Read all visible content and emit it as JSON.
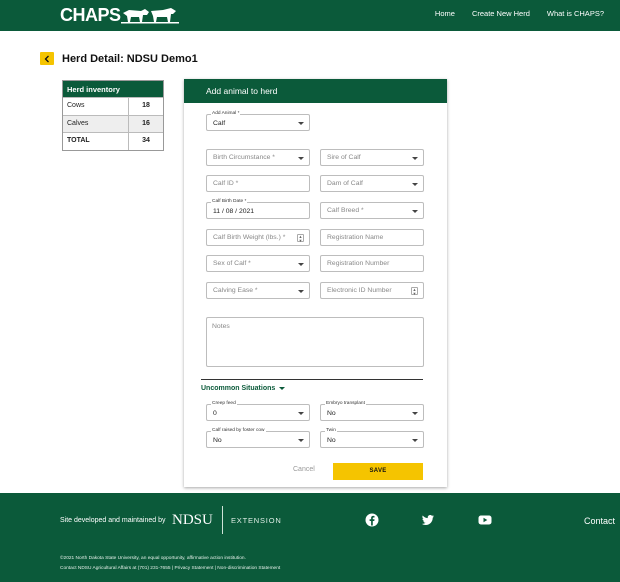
{
  "brand": {
    "logo_text": "CHAPS"
  },
  "nav": {
    "home": "Home",
    "create": "Create New Herd",
    "what": "What is CHAPS?"
  },
  "page": {
    "title": "Herd Detail: NDSU Demo1"
  },
  "inventory": {
    "heading": "Herd inventory",
    "rows": [
      {
        "label": "Cows",
        "value": "18"
      },
      {
        "label": "Calves",
        "value": "16"
      },
      {
        "label": "TOTAL",
        "value": "34"
      }
    ]
  },
  "form": {
    "heading": "Add animal to herd",
    "add_animal": {
      "label": "Add Animal *",
      "value": "Calf"
    },
    "birth_circumstance": {
      "placeholder": "Birth Circumstance *"
    },
    "sire_of_calf": {
      "placeholder": "Sire of Calf"
    },
    "calf_id": {
      "placeholder": "Calf ID *"
    },
    "dam_of_calf": {
      "placeholder": "Dam of Calf"
    },
    "birth_date": {
      "label": "Calf Birth Date *",
      "value": "11 / 08 / 2021"
    },
    "calf_breed": {
      "placeholder": "Calf Breed *"
    },
    "birth_weight": {
      "placeholder": "Calf Birth Weight (lbs.) *"
    },
    "registration_name": {
      "placeholder": "Registration Name"
    },
    "sex_of_calf": {
      "placeholder": "Sex of Calf *"
    },
    "registration_number": {
      "placeholder": "Registration Number"
    },
    "calving_ease": {
      "placeholder": "Calving Ease *"
    },
    "electronic_id": {
      "placeholder": "Electronic ID Number"
    },
    "notes": {
      "placeholder": "Notes"
    },
    "uncommon": {
      "label": "Uncommon Situations"
    },
    "creep_feed": {
      "label": "Creep feed",
      "value": "0"
    },
    "embryo_transplant": {
      "label": "Embryo transplant",
      "value": "No"
    },
    "foster_cow": {
      "label": "Calf raised by foster cow",
      "value": "No"
    },
    "twin": {
      "label": "Twin",
      "value": "No"
    },
    "cancel": "Cancel",
    "save": "SAVE"
  },
  "footer": {
    "site_text": "Site developed and maintained by",
    "ndsu": "NDSU",
    "extension": "EXTENSION",
    "contact": "Contact",
    "copyright": "©2021 North Dakota State University, an equal opportunity, affirmative action institution.",
    "links": "Contact NDSU Agricultural Affairs at (701) 231-7655 | Privacy Statement | Non-discrimination Statement",
    "social": [
      "facebook-icon",
      "twitter-icon",
      "youtube-icon"
    ]
  },
  "colors": {
    "brand_green": "#0b5a3a",
    "accent_yellow": "#f5c400"
  }
}
